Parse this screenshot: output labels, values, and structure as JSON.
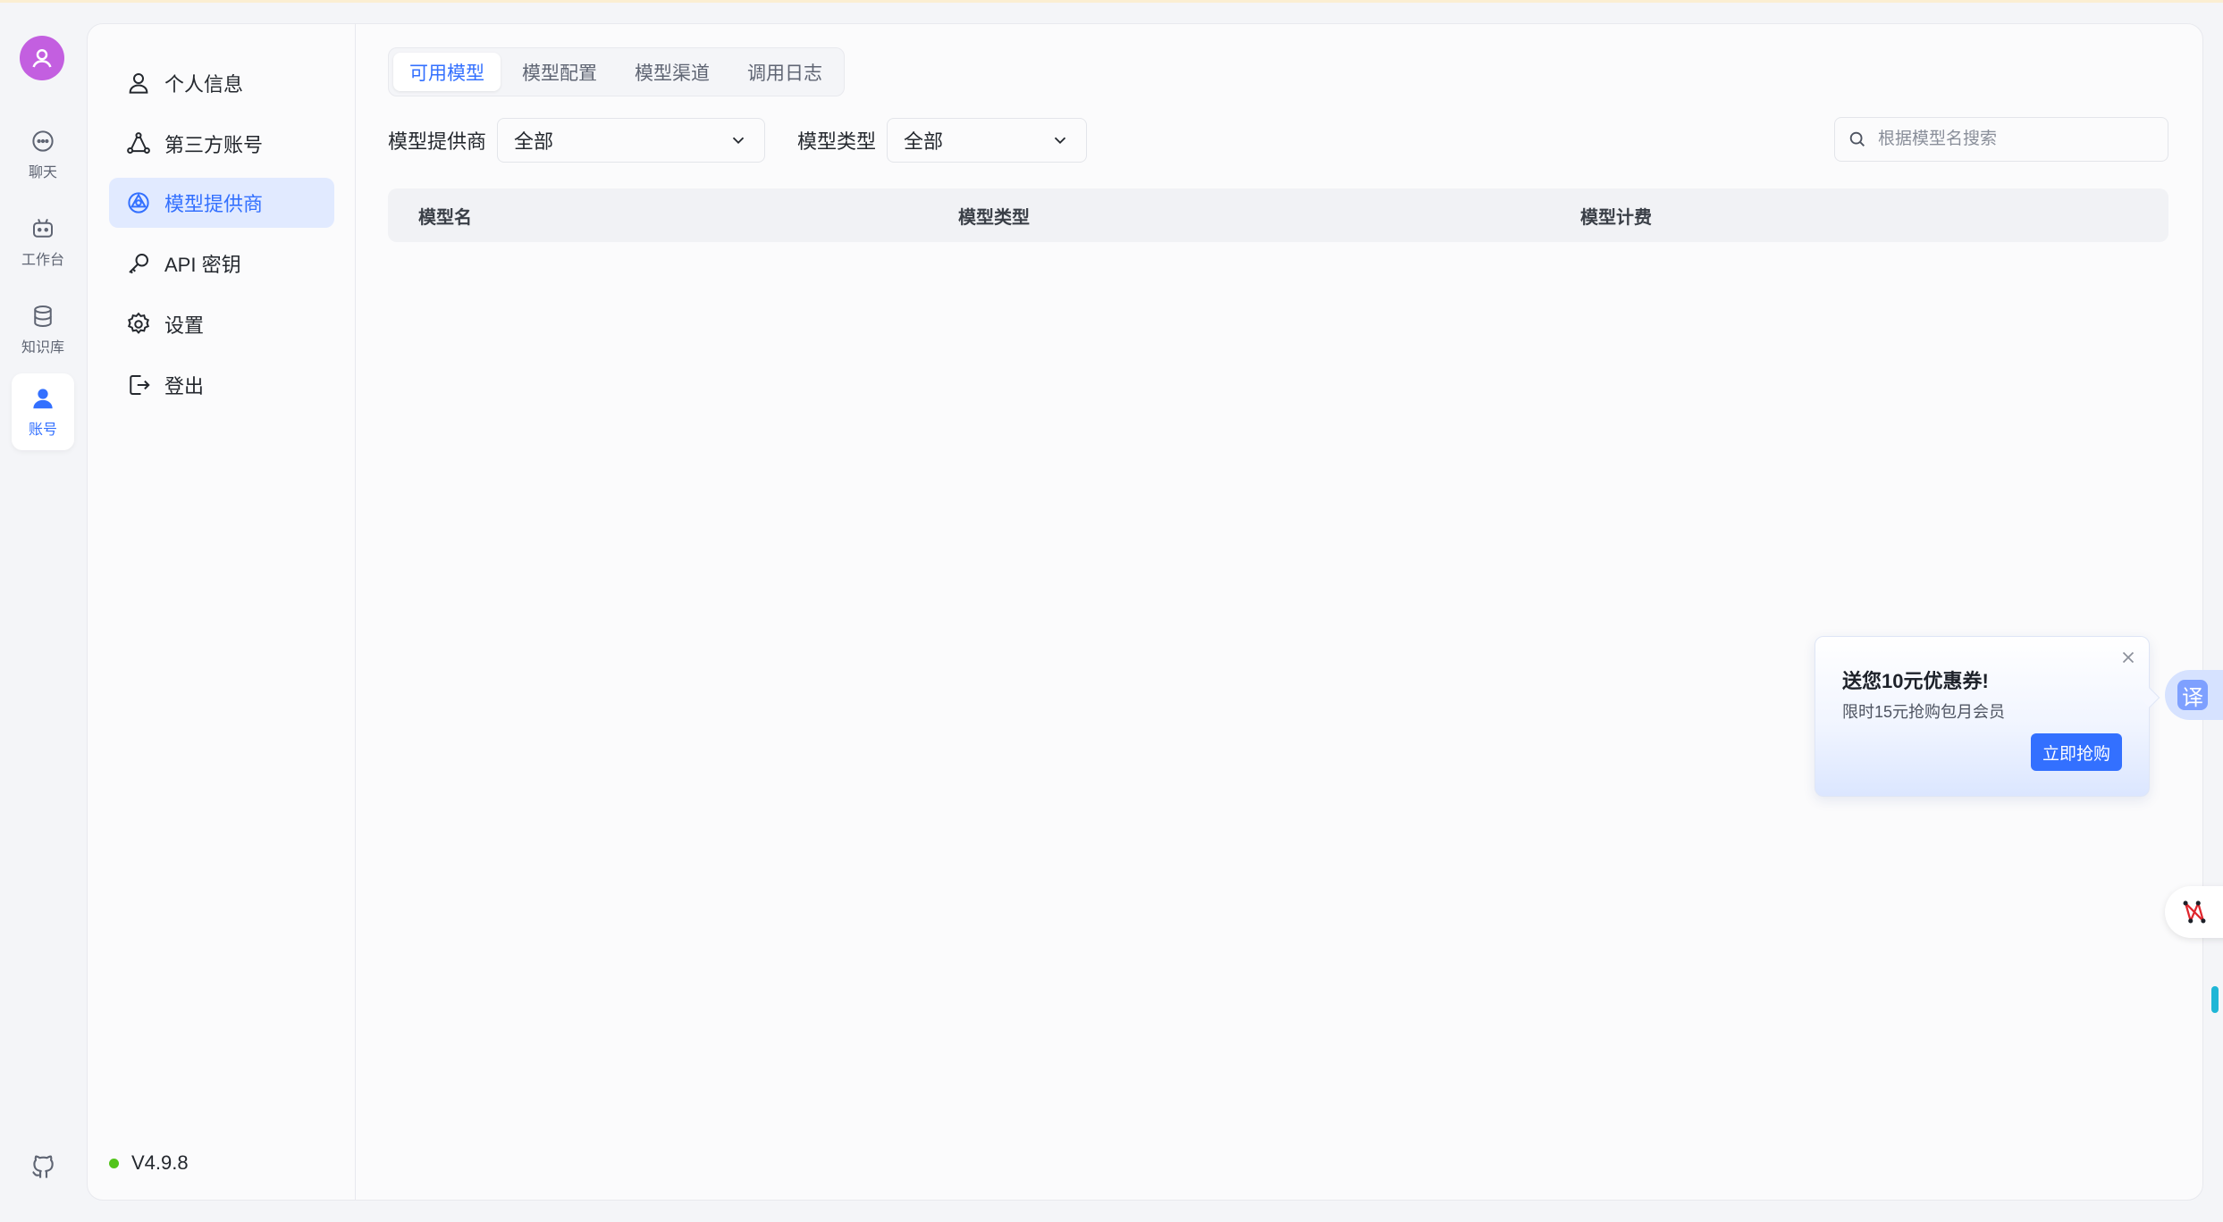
{
  "nav": {
    "items": [
      {
        "id": "chat",
        "label": "聊天",
        "icon": "chat-bubble-icon"
      },
      {
        "id": "workbench",
        "label": "工作台",
        "icon": "robot-icon"
      },
      {
        "id": "knowledge",
        "label": "知识库",
        "icon": "database-icon"
      },
      {
        "id": "account",
        "label": "账号",
        "icon": "user-icon",
        "active": true
      }
    ],
    "github_icon": "github-icon"
  },
  "menu": {
    "items": [
      {
        "label": "个人信息",
        "icon": "user-outline-icon"
      },
      {
        "label": "第三方账号",
        "icon": "link-triangle-icon"
      },
      {
        "label": "模型提供商",
        "icon": "model-provider-icon",
        "active": true
      },
      {
        "label": "API 密钥",
        "icon": "key-icon"
      },
      {
        "label": "设置",
        "icon": "gear-icon"
      },
      {
        "label": "登出",
        "icon": "logout-icon"
      }
    ],
    "version": "V4.9.8",
    "status_color": "#52c41a"
  },
  "tabs": [
    {
      "label": "可用模型",
      "active": true
    },
    {
      "label": "模型配置"
    },
    {
      "label": "模型渠道"
    },
    {
      "label": "调用日志"
    }
  ],
  "filters": {
    "provider_label": "模型提供商",
    "provider_value": "全部",
    "type_label": "模型类型",
    "type_value": "全部"
  },
  "search": {
    "placeholder": "根据模型名搜索",
    "value": ""
  },
  "table": {
    "columns": [
      "模型名",
      "模型类型",
      "模型计费"
    ],
    "rows": []
  },
  "promo": {
    "title": "送您10元优惠券!",
    "subtitle": "限时15元抢购包月会员",
    "button": "立即抢购"
  },
  "widgets": {
    "translate_label": "译"
  },
  "colors": {
    "accent": "#3370ff",
    "active_bg": "#e1eaff",
    "avatar": "#c35fe0"
  }
}
